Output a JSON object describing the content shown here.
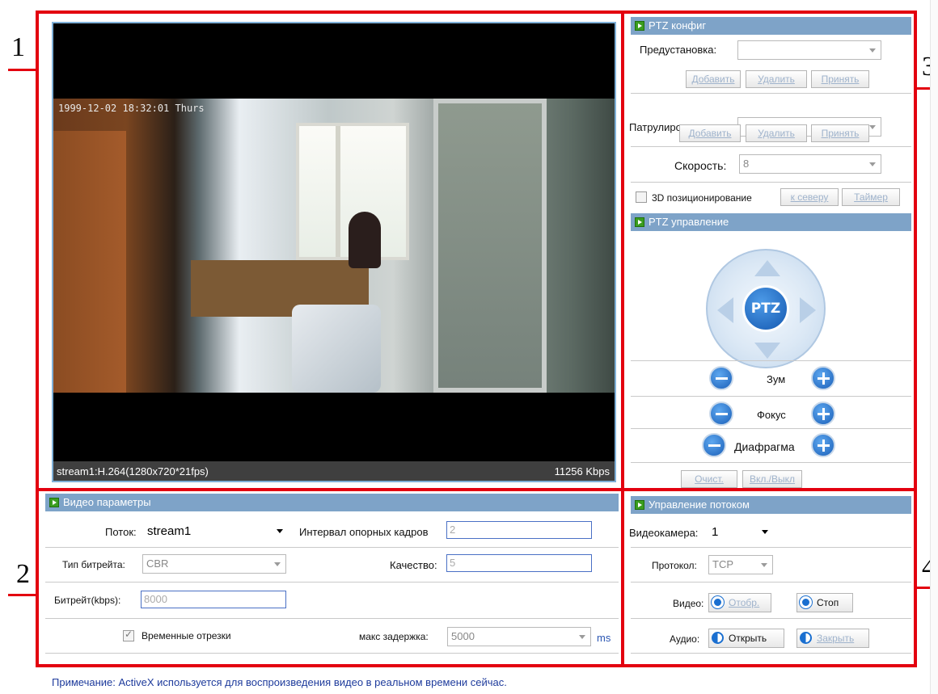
{
  "callouts": [
    "1",
    "2",
    "3",
    "4"
  ],
  "video": {
    "osd_time": "1999-12-02 18:32:01 Thurs",
    "stream_info": "stream1:H.264(1280x720*21fps)",
    "bitrate": "11256 Kbps"
  },
  "ptz_config": {
    "title": "PTZ конфиг",
    "preset_label": "Предустановка:",
    "preset_value": "",
    "patrol_label": "Патрулирование:",
    "patrol_value": "",
    "add": "Добавить",
    "delete": "Удалить",
    "accept": "Принять",
    "speed_label": "Скорость:",
    "speed_value": "8",
    "pos3d_label": "3D позиционирование",
    "north_btn": "к северу",
    "timer_btn": "Таймер"
  },
  "ptz_control": {
    "title": "PTZ управление",
    "center_label": "PTZ",
    "zoom": "Зум",
    "focus": "Фокус",
    "iris": "Диафрагма",
    "clear_btn": "Очист.",
    "onoff_btn": "Вкл./Выкл"
  },
  "video_params": {
    "title": "Видео параметры",
    "stream_label": "Поток:",
    "stream_value": "stream1",
    "keyframe_label": "Интервал опорных кадров",
    "keyframe_value": "2",
    "bitrate_type_label": "Тип битрейта:",
    "bitrate_type_value": "CBR",
    "quality_label": "Качество:",
    "quality_value": "5",
    "bitrate_label": "Битрейт(kbps):",
    "bitrate_value": "8000",
    "timeslices_label": "Временные отрезки",
    "timeslices_checked": true,
    "max_delay_label": "макс задержка:",
    "max_delay_value": "5000",
    "max_delay_unit": "ms"
  },
  "stream_control": {
    "title": "Управление потоком",
    "camera_label": "Видеокамера:",
    "camera_value": "1",
    "protocol_label": "Протокол:",
    "protocol_value": "TCP",
    "video_label": "Видео:",
    "video_show": "Отобр.",
    "video_stop": "Стоп",
    "audio_label": "Аудио:",
    "audio_open": "Открыть",
    "audio_close": "Закрыть"
  },
  "note": "Примечание: ActiveX используется для воспроизведения видео в реальном времени сейчас."
}
